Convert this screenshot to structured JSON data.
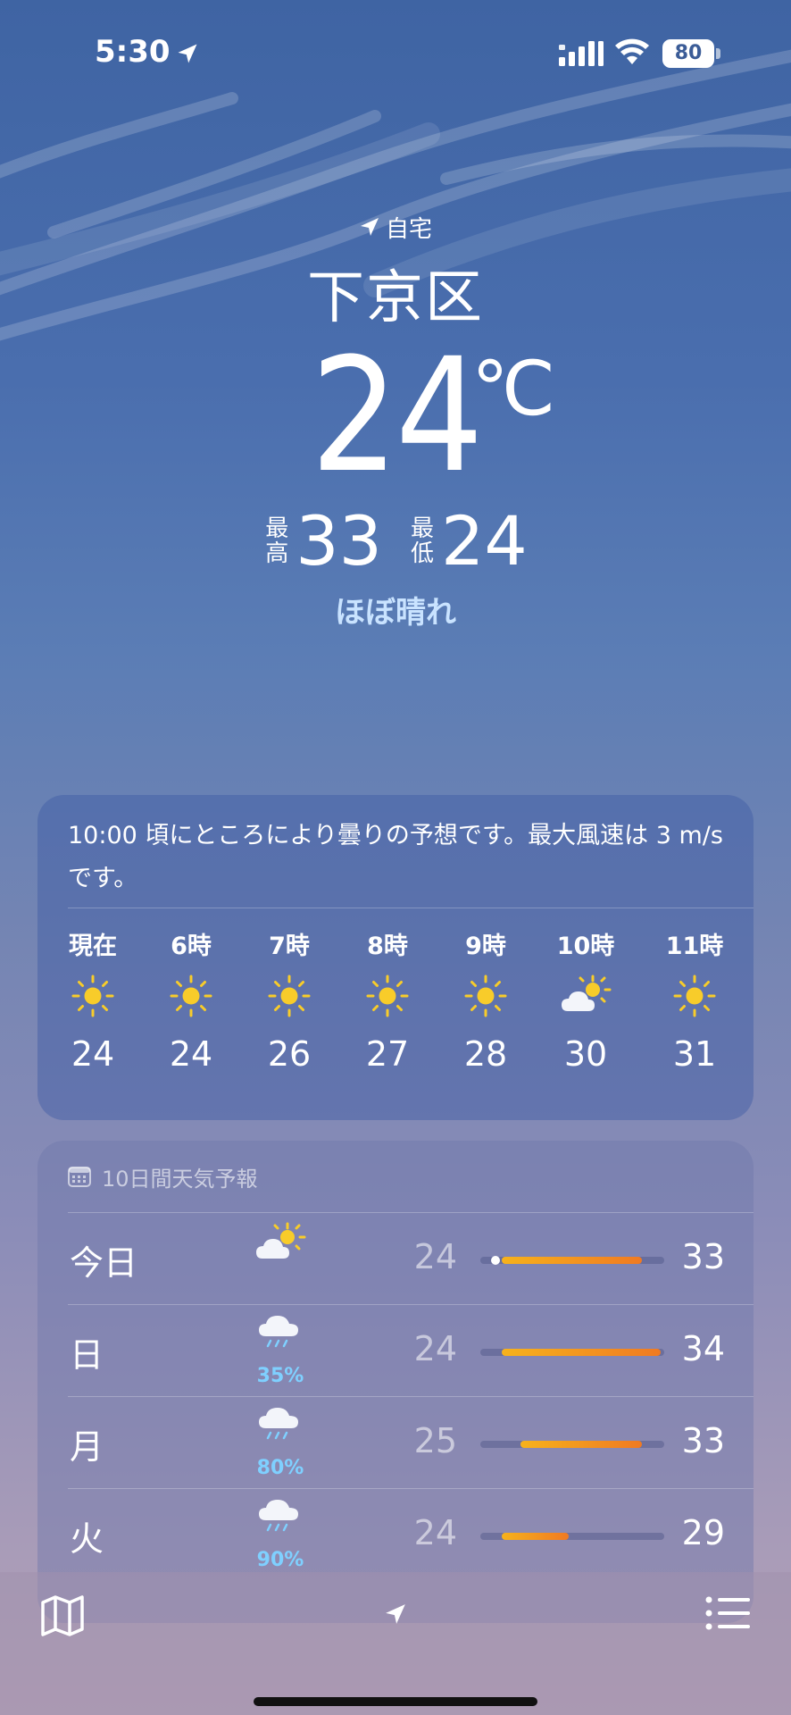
{
  "status_bar": {
    "time": "5:30",
    "battery": "80"
  },
  "header": {
    "home_label": "自宅",
    "city": "下京区",
    "temperature": "24",
    "unit": "℃",
    "high_label": "最高",
    "high": "33",
    "low_label": "最低",
    "low": "24",
    "condition": "ほぼ晴れ"
  },
  "hourly": {
    "summary": "10:00 頃にところにより曇りの予想です。最大風速は 3 m/s です。",
    "items": [
      {
        "label": "現在",
        "icon": "sun-icon",
        "temp": "24"
      },
      {
        "label": "6時",
        "icon": "sun-icon",
        "temp": "24"
      },
      {
        "label": "7時",
        "icon": "sun-icon",
        "temp": "26"
      },
      {
        "label": "8時",
        "icon": "sun-icon",
        "temp": "27"
      },
      {
        "label": "9時",
        "icon": "sun-icon",
        "temp": "28"
      },
      {
        "label": "10時",
        "icon": "partly-cloudy-icon",
        "temp": "30"
      },
      {
        "label": "11時",
        "icon": "sun-icon",
        "temp": "31"
      }
    ]
  },
  "daily": {
    "header": "10日間天気予報",
    "range_min": 24,
    "range_max": 34,
    "rows": [
      {
        "day": "今日",
        "icon": "partly-cloudy-icon",
        "pct": "",
        "low": "24",
        "high": "33",
        "current": 24
      },
      {
        "day": "日",
        "icon": "rain-cloud-icon",
        "pct": "35%",
        "low": "24",
        "high": "34"
      },
      {
        "day": "月",
        "icon": "rain-cloud-icon",
        "pct": "80%",
        "low": "25",
        "high": "33"
      },
      {
        "day": "火",
        "icon": "rain-cloud-icon",
        "pct": "90%",
        "low": "24",
        "high": "29"
      }
    ]
  },
  "colors": {
    "accent_condition": "#c9e3ff",
    "precip": "#7fd0ff",
    "bar_start": "#f7b21c",
    "bar_end": "#f07a22"
  }
}
